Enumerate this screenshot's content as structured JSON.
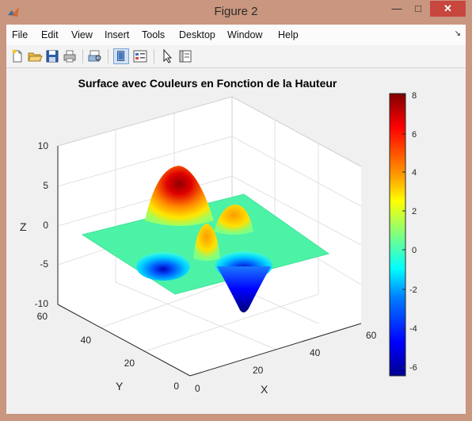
{
  "window": {
    "title": "Figure 2"
  },
  "menu": [
    "File",
    "Edit",
    "View",
    "Insert",
    "Tools",
    "Desktop",
    "Window",
    "Help"
  ],
  "toolbar_icons": [
    "new-figure-icon",
    "open-file-icon",
    "save-icon",
    "print-icon",
    "print-preview-icon",
    "docked-figure-icon",
    "plot-tools-icon",
    "pointer-icon",
    "property-editor-icon"
  ],
  "figure": {
    "title": "Surface avec Couleurs en Fonction de la Hauteur",
    "x_label": "X",
    "y_label": "Y",
    "z_label": "Z"
  },
  "chart_data": {
    "type": "surface",
    "title": "Surface avec Couleurs en Fonction de la Hauteur",
    "xlabel": "X",
    "ylabel": "Y",
    "zlabel": "Z",
    "xlim": [
      0,
      60
    ],
    "ylim": [
      0,
      60
    ],
    "zlim": [
      -10,
      10
    ],
    "x_ticks": [
      "0",
      "20",
      "40",
      "60"
    ],
    "y_ticks": [
      "0",
      "20",
      "40",
      "60"
    ],
    "z_ticks": [
      "-10",
      "-5",
      "0",
      "5",
      "10"
    ],
    "colormap": "jet",
    "colorbar_range": [
      -6.5,
      8
    ],
    "colorbar_ticks": [
      "8",
      "6",
      "4",
      "2",
      "0",
      "-2",
      "-4",
      "-6"
    ],
    "surface_peaks": [
      {
        "type": "max",
        "approx_z": 8
      },
      {
        "type": "min",
        "approx_z": -6.5
      }
    ],
    "grid": true
  }
}
